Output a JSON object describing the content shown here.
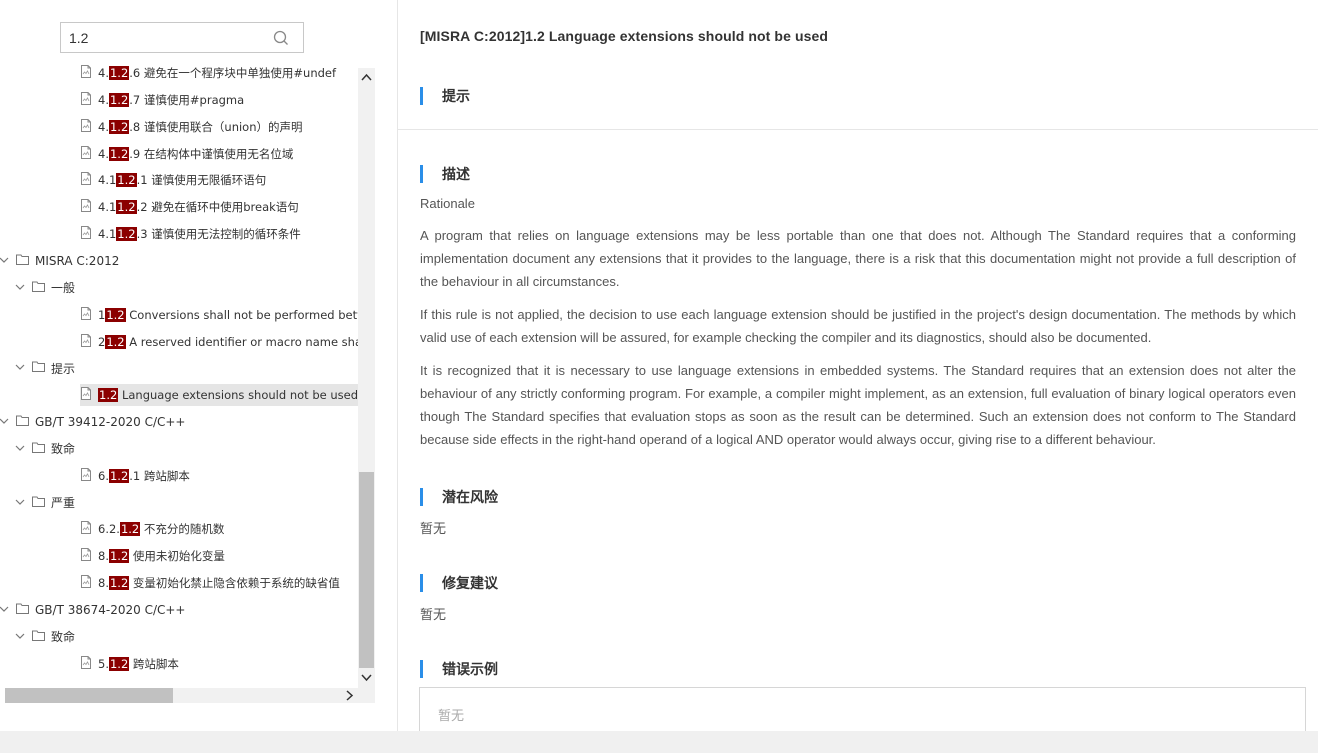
{
  "search": {
    "value": "1.2"
  },
  "tree": {
    "rows": [
      {
        "type": "leaf",
        "pre": "4.",
        "hl": "1.2",
        "post": ".6 避免在一个程序块中单独使用#undef"
      },
      {
        "type": "leaf",
        "pre": "4.",
        "hl": "1.2",
        "post": ".7 谨慎使用#pragma"
      },
      {
        "type": "leaf",
        "pre": "4.",
        "hl": "1.2",
        "post": ".8 谨慎使用联合（union）的声明"
      },
      {
        "type": "leaf",
        "pre": "4.",
        "hl": "1.2",
        "post": ".9 在结构体中谨慎使用无名位域"
      },
      {
        "type": "leaf",
        "pre": "4.1",
        "hl": "1.2",
        "post": ".1 谨慎使用无限循环语句"
      },
      {
        "type": "leaf",
        "pre": "4.1",
        "hl": "1.2",
        "post": ".2 避免在循环中使用break语句"
      },
      {
        "type": "leaf",
        "pre": "4.1",
        "hl": "1.2",
        "post": ".3 谨慎使用无法控制的循环条件"
      },
      {
        "type": "folder",
        "label": "MISRA C:2012"
      },
      {
        "type": "folder",
        "label": "一般"
      },
      {
        "type": "leaf",
        "pre": "1",
        "hl": "1.2",
        "post": " Conversions shall not be performed between"
      },
      {
        "type": "leaf",
        "pre": "2",
        "hl": "1.2",
        "post": " A reserved identifier or macro name shall not"
      },
      {
        "type": "folder",
        "label": "提示"
      },
      {
        "type": "leaf",
        "pre": "",
        "hl": "1.2",
        "post": " Language extensions should not be used",
        "selected": true
      },
      {
        "type": "folder",
        "label": "GB/T 39412-2020 C/C++"
      },
      {
        "type": "folder",
        "label": "致命"
      },
      {
        "type": "leaf",
        "pre": "6.",
        "hl": "1.2",
        "post": ".1 跨站脚本"
      },
      {
        "type": "folder",
        "label": "严重"
      },
      {
        "type": "leaf",
        "pre": "6.2.",
        "hl": "1.2",
        "post": " 不充分的随机数"
      },
      {
        "type": "leaf",
        "pre": "8.",
        "hl": "1.2",
        "post": " 使用未初始化变量"
      },
      {
        "type": "leaf",
        "pre": "8.",
        "hl": "1.2",
        "post": " 变量初始化禁止隐含依赖于系统的缺省值"
      },
      {
        "type": "folder",
        "label": "GB/T 38674-2020 C/C++"
      },
      {
        "type": "folder",
        "label": "致命"
      },
      {
        "type": "leaf",
        "pre": "5.",
        "hl": "1.2",
        "post": " 跨站脚本"
      }
    ]
  },
  "detail": {
    "title": "[MISRA C:2012]1.2 Language extensions should not be used",
    "sections": {
      "hint": "提示",
      "description": "描述",
      "risk": "潜在风险",
      "fix": "修复建议",
      "error_example": "错误示例"
    },
    "description_paragraphs": [
      "Rationale",
      "A program that relies on language extensions may be less portable than one that does not. Although The Standard requires that a conforming implementation document any extensions that it provides to the language, there is a risk that this documentation might not provide a full description of the behaviour in all circumstances.",
      "If this rule is not applied, the decision to use each language extension should be justified in the project's design documentation. The methods by which valid use of each extension will be assured, for example checking the compiler and its diagnostics, should also be documented.",
      "It is recognized that it is necessary to use language extensions in embedded systems. The Standard requires that an extension does not alter the behaviour of any strictly conforming program. For example, a compiler might implement, as an extension, full evaluation of binary logical operators even though The Standard specifies that evaluation stops as soon as the result can be determined. Such an extension does not conform to The Standard because side effects in the right-hand operand of a logical AND operator would always occur, giving rise to a different behaviour."
    ],
    "risk_text": "暂无",
    "fix_text": "暂无",
    "error_example_text": "暂无"
  },
  "colors": {
    "accent": "#2a8ee8",
    "highlight": "#8b0000"
  }
}
